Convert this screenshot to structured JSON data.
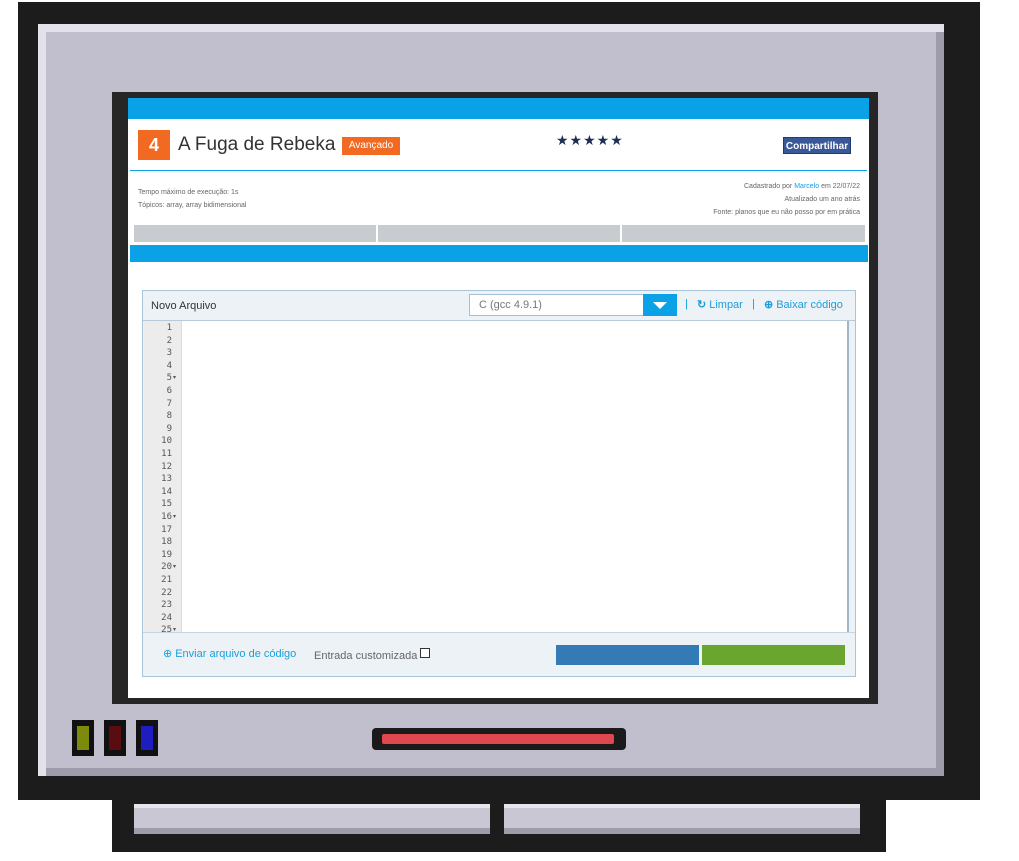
{
  "problem": {
    "number": "4",
    "title": "A Fuga de Rebeka",
    "level": "Avançado",
    "rating_stars": 5,
    "stars_text": "★★★★★",
    "share_label": "Compartilhar",
    "time_limit": "Tempo máximo de execução: 1s",
    "topics": "Tópicos: array, array bidimensional",
    "registered_prefix": "Cadastrado por",
    "registered_by": "Marcelo",
    "registered_suffix": "em 22/07/22",
    "updated": "Atualizado um ano atrás",
    "source": "Fonte: planos que eu não posso por em prática"
  },
  "tabs": [
    "",
    "",
    ""
  ],
  "editor": {
    "file_name": "Novo Arquivo",
    "language": "C (gcc 4.9.1)",
    "clear_label": "Limpar",
    "download_label": "Baixar código",
    "line_numbers": [
      "1",
      "2",
      "3",
      "4",
      "5",
      "6",
      "7",
      "8",
      "9",
      "10",
      "11",
      "12",
      "13",
      "14",
      "15",
      "16",
      "17",
      "18",
      "19",
      "20",
      "21",
      "22",
      "23",
      "24",
      "25"
    ],
    "foldable_lines": [
      "5",
      "16",
      "20",
      "25"
    ],
    "upload_label": "Enviar arquivo de código",
    "custom_input_label": "Entrada customizada",
    "custom_input_checked": false
  },
  "colors": {
    "accent_blue": "#0ba1e6",
    "badge_orange": "#f26a22",
    "share_blue": "#3a5898",
    "button_blue": "#337ab7",
    "button_green": "#6aa52f",
    "led_green": "#7e8a0c",
    "led_red": "#5a0c10",
    "led_blue": "#1e1ec0",
    "slot_red": "#e04850"
  },
  "icons": {
    "clear": "refresh-icon",
    "download": "download-circle-icon",
    "upload": "upload-circle-icon",
    "dropdown": "caret-down-icon"
  }
}
